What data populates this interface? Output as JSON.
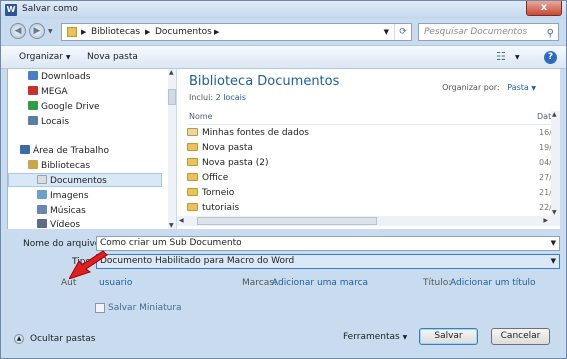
{
  "window": {
    "title": "Salvar como",
    "app_icon": "W",
    "close": "x"
  },
  "address": {
    "segments": [
      "Bibliotecas",
      "Documentos"
    ],
    "search_placeholder": "Pesquisar Documentos"
  },
  "toolbar": {
    "organize": "Organizar",
    "new_folder": "Nova pasta"
  },
  "nav": {
    "items": [
      {
        "label": "Downloads",
        "icon": "downloads-icon",
        "color": "#4b7fc4"
      },
      {
        "label": "MEGA",
        "icon": "mega-icon",
        "color": "#c9302c"
      },
      {
        "label": "Google Drive",
        "icon": "google-drive-icon",
        "color": "#2f9e44"
      },
      {
        "label": "Locais",
        "icon": "places-icon",
        "color": "#5b7ea6"
      },
      {
        "label": "Área de Trabalho",
        "icon": "desktop-icon",
        "color": "#3a6da8"
      },
      {
        "label": "Bibliotecas",
        "icon": "libraries-icon",
        "color": "#c9a64a"
      },
      {
        "label": "Documentos",
        "icon": "documents-icon",
        "color": "#d9dce1"
      },
      {
        "label": "Imagens",
        "icon": "images-icon",
        "color": "#6aa0cf"
      },
      {
        "label": "Músicas",
        "icon": "music-icon",
        "color": "#6a86b5"
      },
      {
        "label": "Vídeos",
        "icon": "videos-icon",
        "color": "#5b6d86"
      }
    ]
  },
  "main": {
    "title": "Biblioteca Documentos",
    "includes_label": "Inclui:",
    "includes_link": "2 locais",
    "arrange_label": "Organizar por:",
    "arrange_value": "Pasta",
    "col_name": "Nome",
    "col_date": "Dat",
    "rows": [
      {
        "name": "Minhas fontes de dados",
        "date": "16/"
      },
      {
        "name": "Nova pasta",
        "date": "19/"
      },
      {
        "name": "Nova pasta (2)",
        "date": "04/"
      },
      {
        "name": "Office",
        "date": "27/"
      },
      {
        "name": "Torneio",
        "date": "21/"
      },
      {
        "name": "tutoriais",
        "date": "22/"
      }
    ]
  },
  "form": {
    "filename_label": "Nome do arquivo:",
    "filename_value": "Como criar um Sub Documento",
    "type_label": "Tipo:",
    "type_value": "Documento Habilitado para Macro do Word",
    "authors_label": "Aut",
    "authors_value": "usuario",
    "tags_label": "Marcas:",
    "tags_link": "Adicionar uma marca",
    "title_label": "Título:",
    "title_link": "Adicionar um título",
    "thumbnail_label": "Salvar Miniatura"
  },
  "footer": {
    "hide_folders": "Ocultar pastas",
    "tools": "Ferramentas",
    "save": "Salvar",
    "cancel": "Cancelar"
  }
}
